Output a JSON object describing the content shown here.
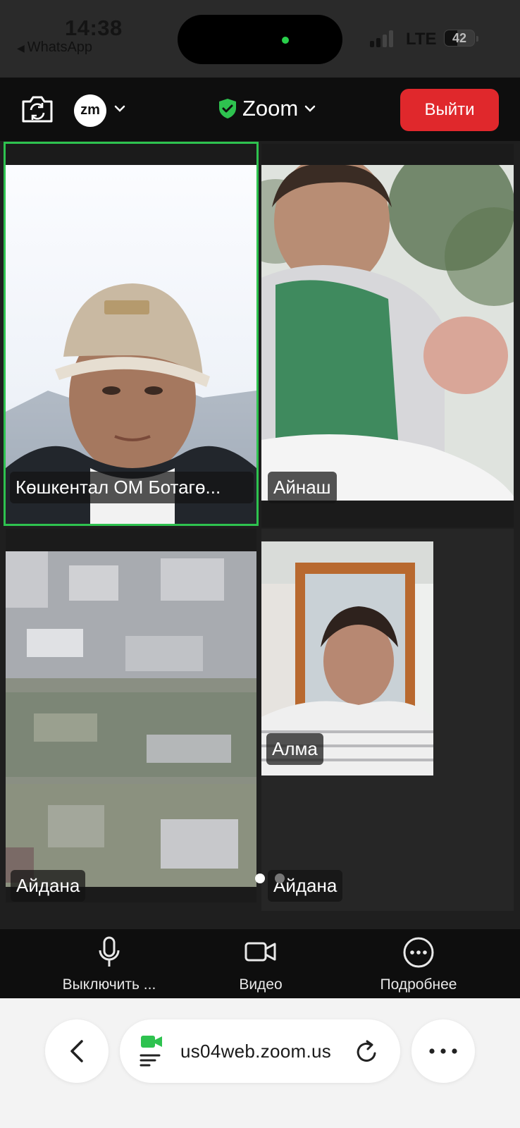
{
  "status_bar": {
    "time": "14:38",
    "back_app": "WhatsApp",
    "network": "LTE",
    "battery": "42",
    "battery_level": 0.42
  },
  "toolbar": {
    "zm_logo": "zm",
    "meeting_title": "Zoom",
    "exit_label": "Выйти",
    "colors": {
      "exit": "#e0282c",
      "shield": "#2ec24f"
    }
  },
  "participants": [
    {
      "name": "Көшкентал ОМ Ботагө...",
      "active_speaker": true
    },
    {
      "name": "Айнаш",
      "active_speaker": false
    },
    {
      "name": "Айдана",
      "active_speaker": false
    },
    {
      "name": "Алма",
      "active_speaker": false
    },
    {
      "name": "Айдана",
      "active_speaker": false
    }
  ],
  "gallery": {
    "page_count": 2,
    "current_page": 1
  },
  "controls": {
    "mute_label": "Выключить ...",
    "video_label": "Видео",
    "more_label": "Подробнее"
  },
  "browser": {
    "url": "us04web.zoom.us",
    "accent": "#2ec24f"
  }
}
